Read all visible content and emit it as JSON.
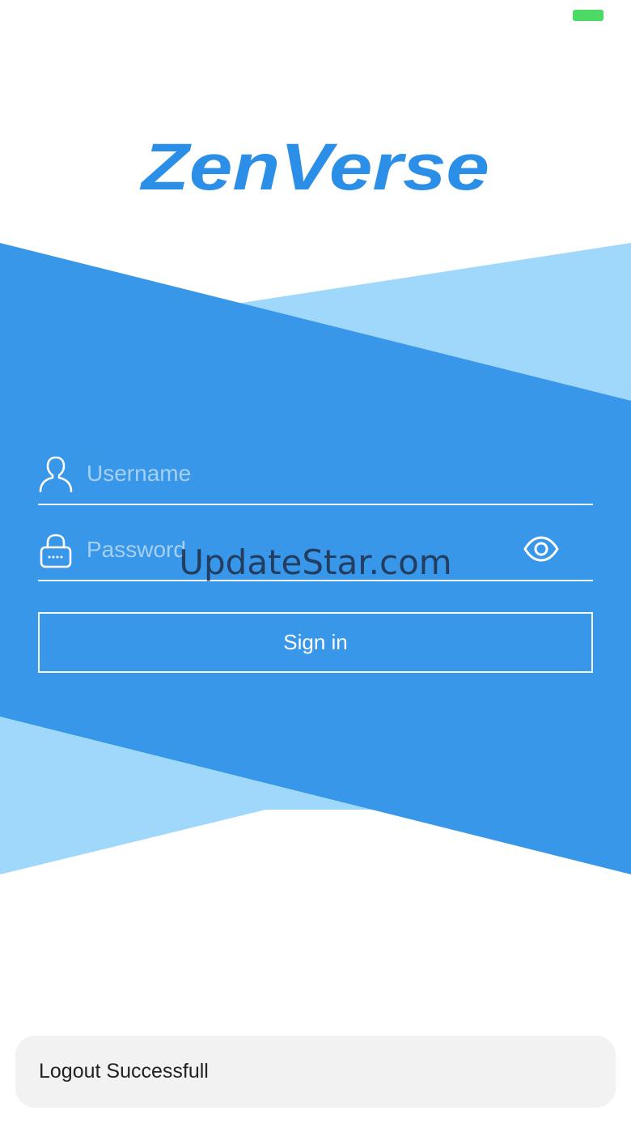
{
  "status_bar": {
    "battery_color": "#4cd964"
  },
  "brand": {
    "logo_text": "ZenVerse",
    "color": "#2b8fe8"
  },
  "colors": {
    "primary_blue": "#3897e8",
    "light_blue": "#9fd8fb",
    "background": "#ffffff"
  },
  "login_form": {
    "username": {
      "placeholder": "Username",
      "value": "",
      "icon": "person-icon"
    },
    "password": {
      "placeholder": "Password",
      "value": "",
      "icon": "lock-icon",
      "toggle_icon": "eye-icon"
    },
    "sign_in_label": "Sign in"
  },
  "watermark": "UpdateStar.com",
  "toast": {
    "message": "Logout Successfull"
  }
}
